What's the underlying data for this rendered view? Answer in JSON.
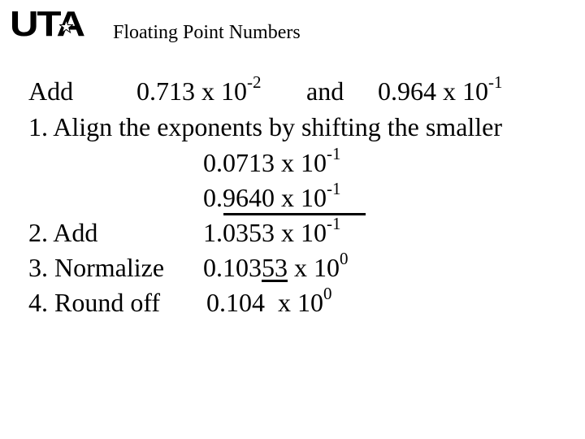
{
  "header": {
    "logo_text": "UTA",
    "logo_icon": "star-icon",
    "title": "Floating Point Numbers"
  },
  "problem": {
    "label": "Add",
    "a_mantissa": "0.713 x 10",
    "a_exp": "-2",
    "conj": "and",
    "b_mantissa": "0.964 x 10",
    "b_exp": "-1"
  },
  "steps": {
    "step1": {
      "label": "1. Align the exponents by shifting the smaller"
    },
    "aligned_a": {
      "mantissa": "0.0713 x 10",
      "exp": "-1"
    },
    "aligned_b": {
      "mantissa": "0.9640 x 10",
      "exp": "-1"
    },
    "step2": {
      "label": "2. Add",
      "mantissa": "1.0353 x 10",
      "exp": "-1"
    },
    "step3": {
      "label": "3. Normalize",
      "m_pre": "0.103",
      "m_ul": "53",
      "m_post": " x 10",
      "exp": "0"
    },
    "step4": {
      "label": "4. Round off",
      "mantissa": "0.104  x 10",
      "exp": "0"
    }
  }
}
